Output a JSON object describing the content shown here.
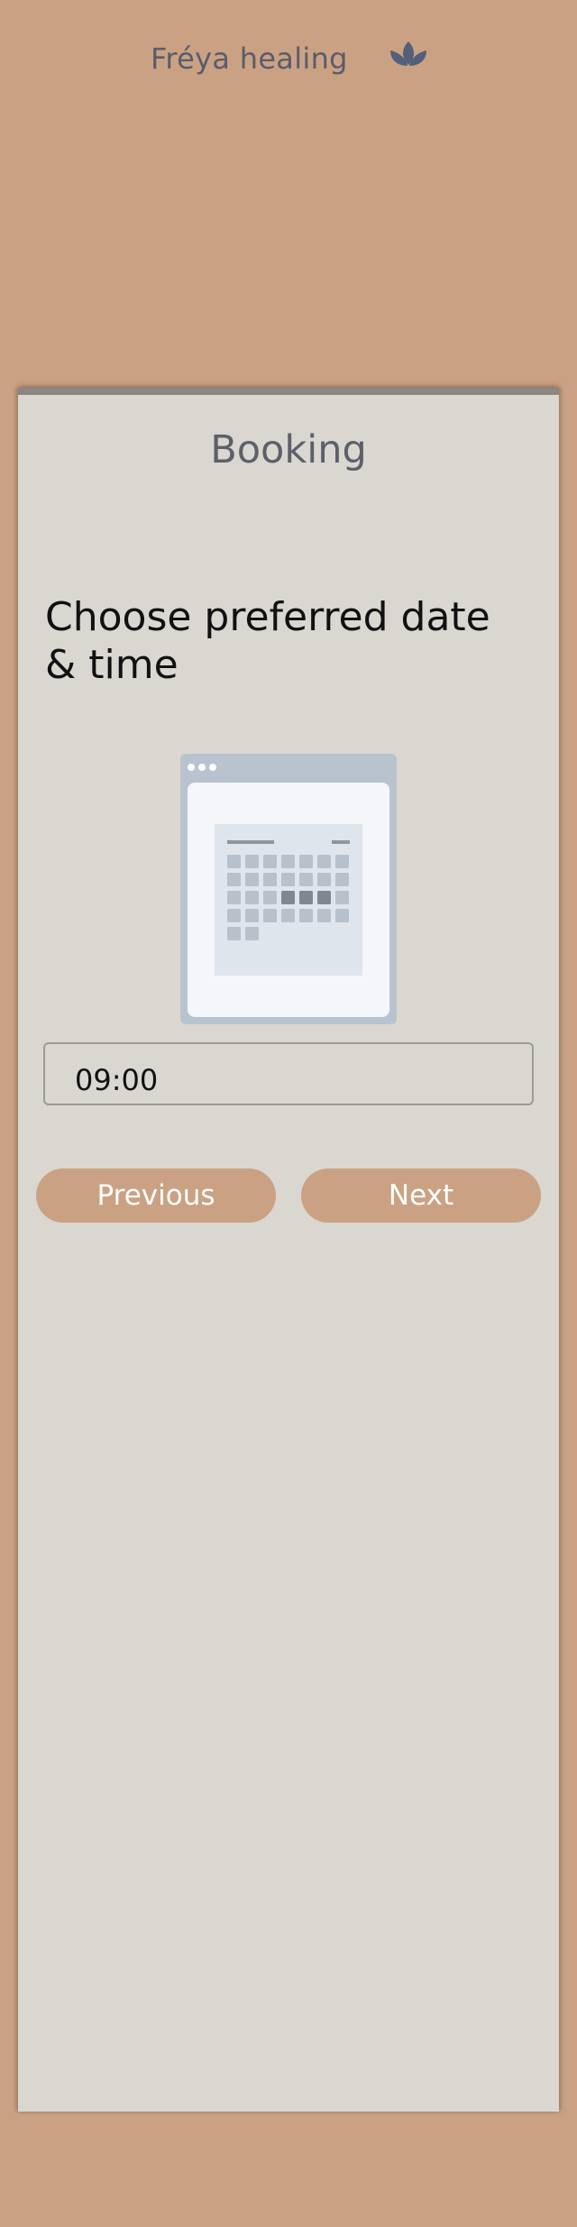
{
  "brand": {
    "name": "Fréya healing",
    "icon": "lotus-icon"
  },
  "colors": {
    "background": "#caa283",
    "card": "#dad7d1",
    "button": "#caa283",
    "icon": "#54607a"
  },
  "booking": {
    "title": "Booking",
    "question": "Choose preferred date & time",
    "illustration": "calendar-illustration",
    "time_value": "09:00"
  },
  "buttons": {
    "previous": "Previous",
    "next": "Next"
  }
}
